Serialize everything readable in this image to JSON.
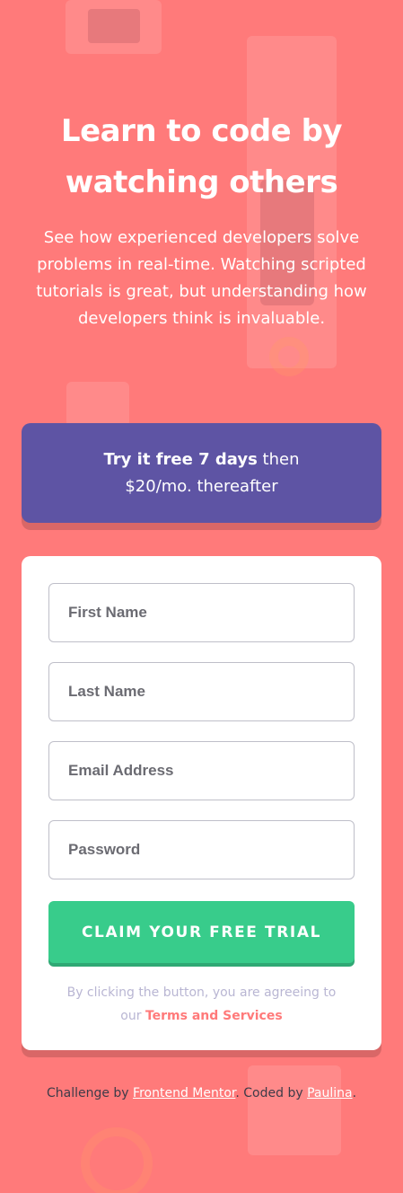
{
  "intro": {
    "title": "Learn to code by watching others",
    "description": "See how experienced developers solve problems in real-time. Watching scripted tutorials is great, but understanding how developers think is invaluable."
  },
  "promo": {
    "bold": "Try it free 7 days",
    "rest_line1": " then",
    "line2": "$20/mo. thereafter"
  },
  "form": {
    "first_name_placeholder": "First Name",
    "last_name_placeholder": "Last Name",
    "email_placeholder": "Email Address",
    "password_placeholder": "Password",
    "submit_label": "CLAIM YOUR FREE TRIAL",
    "terms_prefix": "By clicking the button, you are agreeing to our",
    "terms_link": "Terms and Services"
  },
  "footer": {
    "prefix": "Challenge by ",
    "link1": "Frontend Mentor",
    "middle": ". Coded by ",
    "link2": "Paulina",
    "suffix": "."
  },
  "colors": {
    "background": "#ff7a7a",
    "promo": "#5e54a4",
    "cta": "#38cc8b",
    "terms_link": "#ff7a7a"
  }
}
